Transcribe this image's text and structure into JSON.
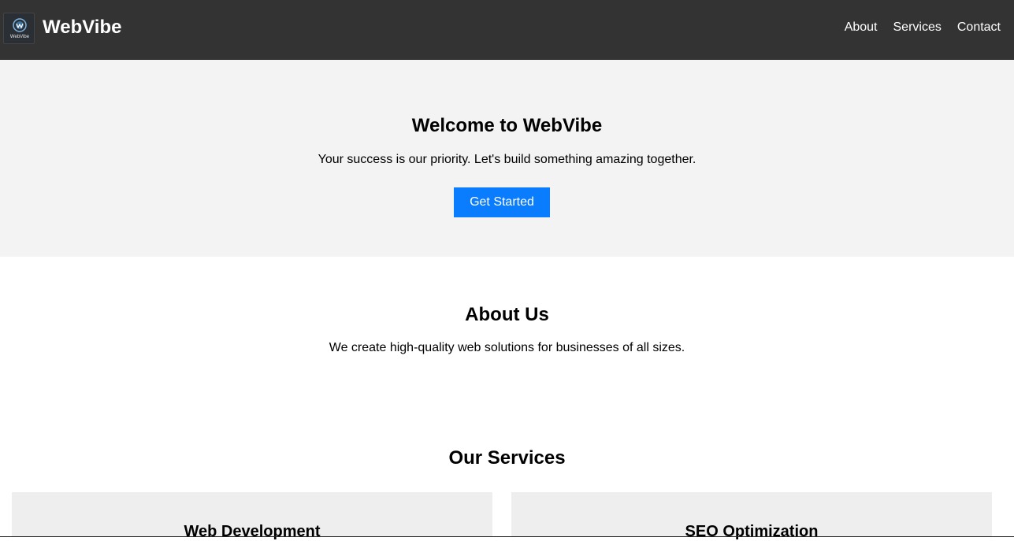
{
  "header": {
    "brand": "WebVibe",
    "logo_text": "WebVibe",
    "nav": [
      "About",
      "Services",
      "Contact"
    ]
  },
  "hero": {
    "title": "Welcome to WebVibe",
    "subtitle": "Your success is our priority. Let's build something amazing together.",
    "cta_label": "Get Started"
  },
  "about": {
    "title": "About Us",
    "text": "We create high-quality web solutions for businesses of all sizes."
  },
  "services": {
    "title": "Our Services",
    "cards": [
      {
        "title": "Web Development"
      },
      {
        "title": "SEO Optimization"
      }
    ]
  },
  "colors": {
    "header_bg": "#333333",
    "hero_bg": "#f3f3f3",
    "accent": "#0a7dff",
    "card_bg": "#eeeeee"
  }
}
